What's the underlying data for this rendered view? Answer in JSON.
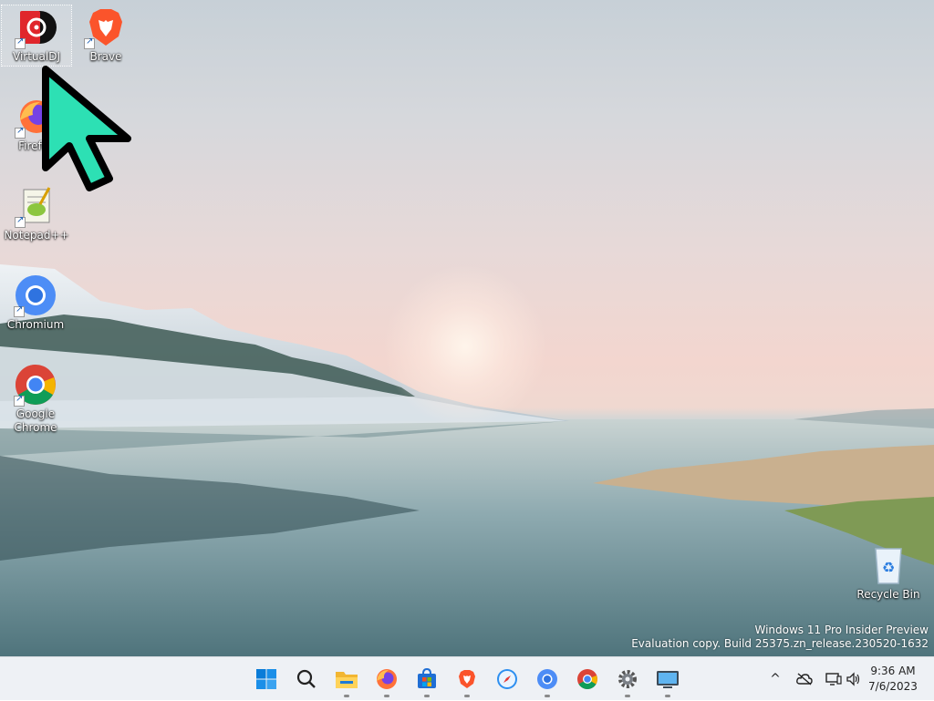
{
  "desktop": {
    "icons": [
      {
        "label": "VirtualDJ",
        "icon": "virtualdj-icon"
      },
      {
        "label": "Brave",
        "icon": "brave-icon"
      },
      {
        "label": "Firefox",
        "icon": "firefox-icon"
      },
      {
        "label": "Notepad++",
        "icon": "notepadpp-icon"
      },
      {
        "label": "Chromium",
        "icon": "chromium-icon"
      },
      {
        "label": "Google Chrome",
        "icon": "chrome-icon"
      },
      {
        "label": "Recycle Bin",
        "icon": "recycle-bin-icon"
      }
    ]
  },
  "watermark": {
    "line1": "Windows 11 Pro Insider Preview",
    "line2": "Evaluation copy. Build 25375.zn_release.230520-1632"
  },
  "taskbar": {
    "apps": [
      "start",
      "search",
      "file-explorer",
      "firefox",
      "microsoft-store",
      "brave",
      "safari",
      "chromium",
      "chrome",
      "settings",
      "remote-desktop"
    ]
  },
  "tray": {
    "time": "9:36 AM",
    "date": "7/6/2023"
  },
  "colors": {
    "taskbar_bg": "#eef1f5",
    "cursor": "#2de0b4"
  }
}
